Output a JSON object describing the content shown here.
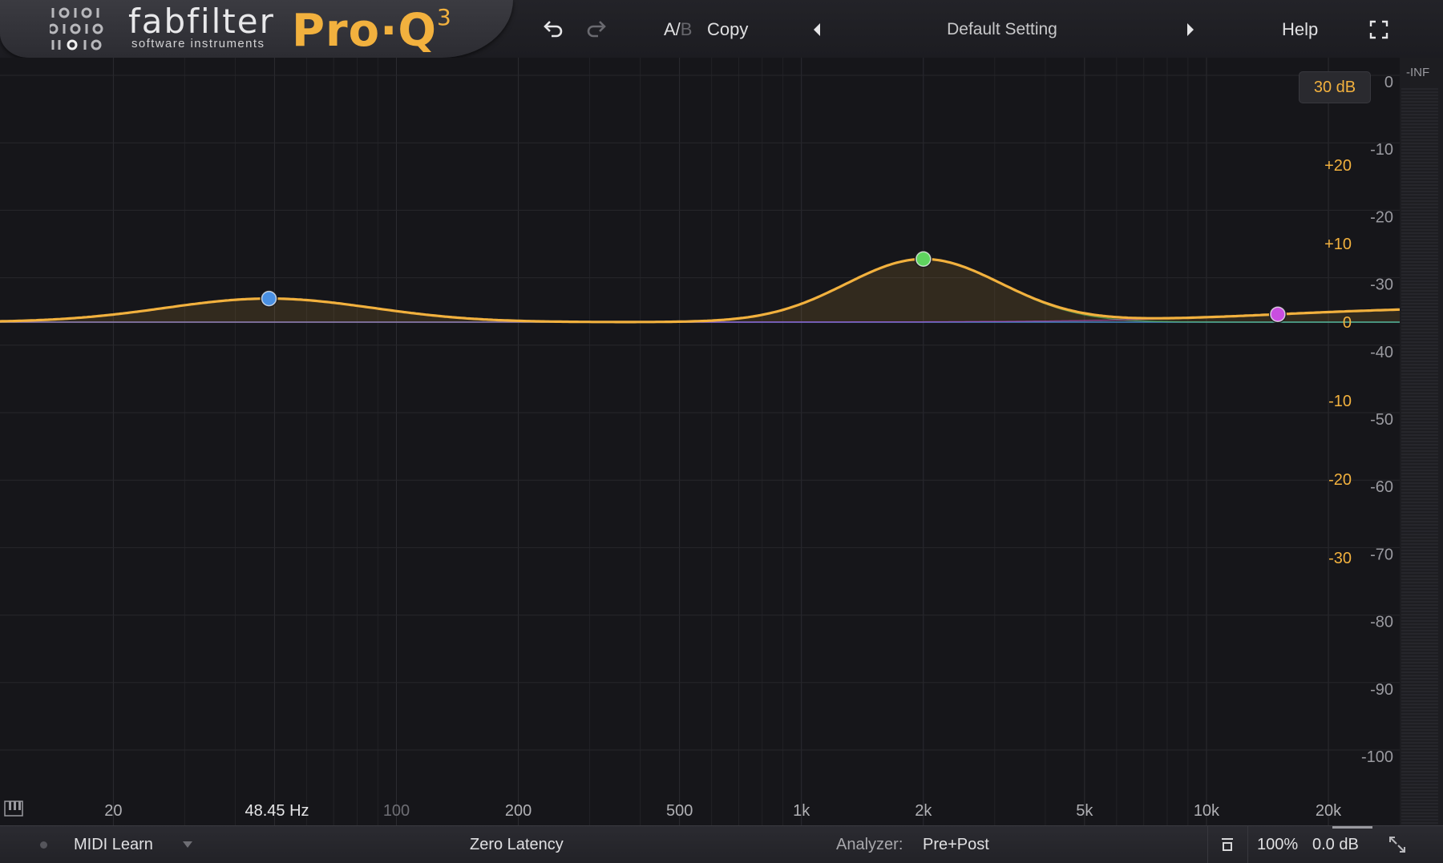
{
  "header": {
    "brand": "fabfilter",
    "brand_sub": "software instruments",
    "product": "Pro·Q",
    "product_version": "3",
    "ab_a": "A/",
    "ab_b": "B",
    "copy_label": "Copy",
    "preset_name": "Default Setting",
    "help_label": "Help",
    "icons": [
      "undo-icon",
      "redo-icon",
      "prev-preset-icon",
      "next-preset-icon",
      "fullscreen-icon"
    ]
  },
  "graph": {
    "range_label": "30 dB",
    "gain_scale": [
      "+20",
      "+10",
      "0",
      "-10",
      "-20",
      "-30"
    ],
    "analyzer_scale": [
      "0",
      "-10",
      "-20",
      "-30",
      "-40",
      "-50",
      "-60",
      "-70",
      "-80",
      "-90",
      "-100"
    ],
    "freq_labels": [
      "20",
      "48.45 Hz",
      "100",
      "200",
      "500",
      "1k",
      "2k",
      "5k",
      "10k",
      "20k"
    ],
    "meter_label": "-INF",
    "bands": [
      {
        "name": "band-1",
        "freq_hz": 48.45,
        "gain_db": 3,
        "color": "#4a90e2"
      },
      {
        "name": "band-2",
        "freq_hz": 2000,
        "gain_db": 8,
        "color": "#5fd35f"
      },
      {
        "name": "band-3",
        "freq_hz": 15000,
        "gain_db": 2,
        "color": "#c94ee0"
      }
    ],
    "curve_color": "#f2b13e"
  },
  "footer": {
    "midi_learn": "MIDI Learn",
    "latency": "Zero Latency",
    "analyzer_label": "Analyzer:",
    "analyzer_value": "Pre+Post",
    "zoom": "100%",
    "output_gain": "0.0 dB"
  }
}
